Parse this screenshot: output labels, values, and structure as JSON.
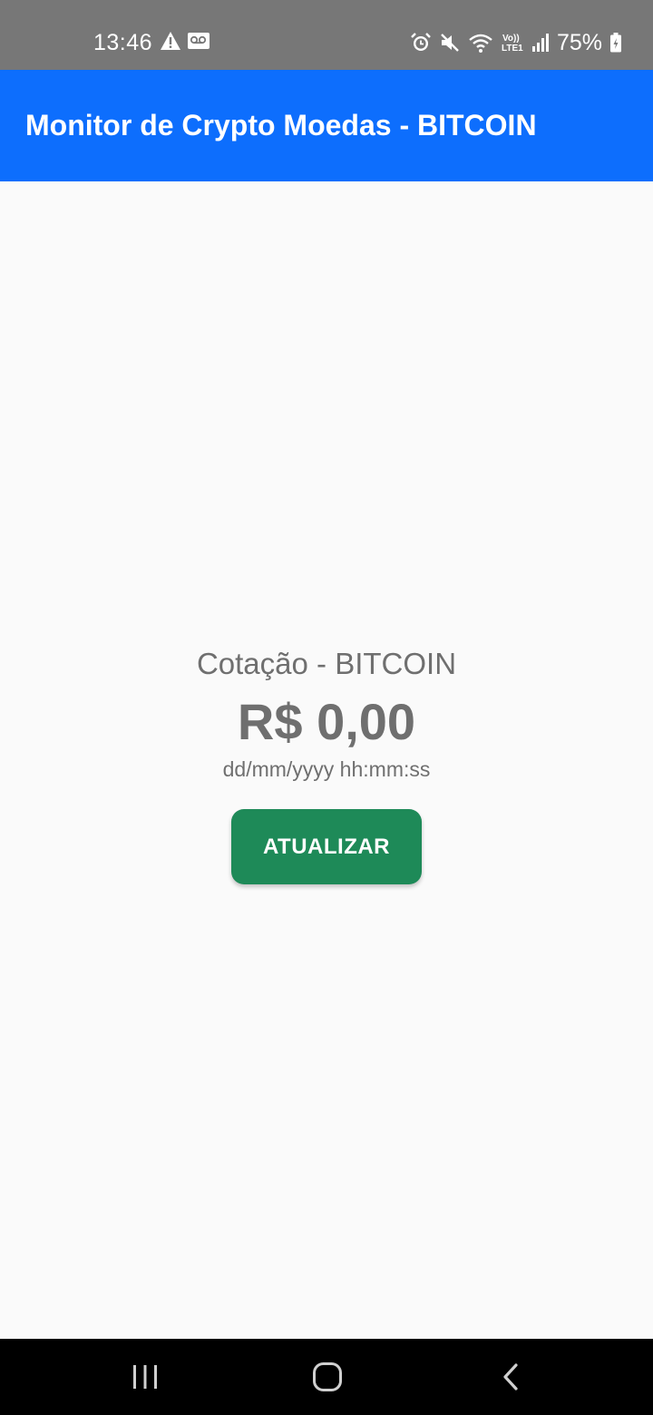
{
  "status_bar": {
    "time": "13:46",
    "battery_percent": "75%",
    "icons": [
      "alert-icon",
      "voicemail-icon",
      "alarm-icon",
      "mute-icon",
      "wifi-icon",
      "volte-icon",
      "signal-icon",
      "battery-icon"
    ]
  },
  "app_bar": {
    "title": "Monitor de Crypto Moedas - BITCOIN",
    "color": "#0d6efd"
  },
  "quote": {
    "label": "Cotação - BITCOIN",
    "value": "R$ 0,00",
    "timestamp": "dd/mm/yyyy hh:mm:ss"
  },
  "refresh_button": {
    "label": "ATUALIZAR",
    "color": "#1e8a58"
  },
  "nav_bar": {
    "buttons": [
      "recent-apps-icon",
      "home-icon",
      "back-icon"
    ]
  }
}
